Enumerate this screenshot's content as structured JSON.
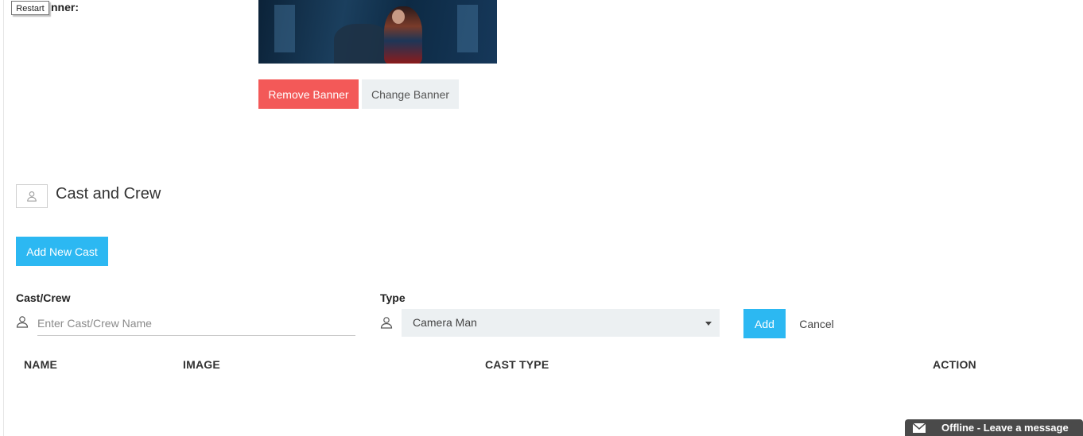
{
  "tooltip": {
    "restart": "Restart"
  },
  "banner": {
    "label": "nner:",
    "remove_label": "Remove Banner",
    "change_label": "Change Banner"
  },
  "cast_section": {
    "title": "Cast and Crew",
    "add_new_label": "Add New Cast"
  },
  "form": {
    "cast_label": "Cast/Crew",
    "cast_placeholder": "Enter Cast/Crew Name",
    "cast_value": "",
    "type_label": "Type",
    "type_selected": "Camera Man",
    "add_label": "Add",
    "cancel_label": "Cancel"
  },
  "table": {
    "columns": [
      "NAME",
      "IMAGE",
      "CAST TYPE",
      "ACTION"
    ],
    "rows": []
  },
  "chat": {
    "label": "Offline - Leave a message"
  },
  "colors": {
    "danger": "#f35958",
    "primary": "#2cb8f2",
    "light": "#ecf0f2",
    "chat": "#4a4a4a"
  },
  "icons": {
    "section": "user-icon",
    "field": "user-icon",
    "select": "caret-down-icon",
    "chat": "mail-icon"
  }
}
